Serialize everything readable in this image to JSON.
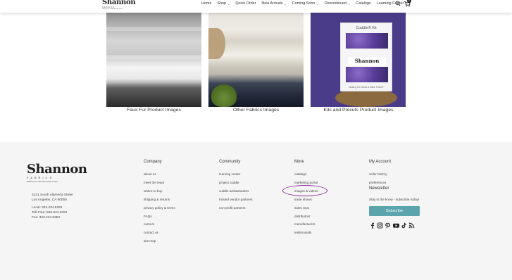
{
  "header": {
    "logo": {
      "brand": "Shannon",
      "sub": "FABRICS",
      "tag": "Making The World A Softer Place"
    },
    "nav": [
      {
        "label": "Home",
        "dropdown": false
      },
      {
        "label": "Shop",
        "dropdown": true
      },
      {
        "label": "Quick Order",
        "dropdown": false
      },
      {
        "label": "New Arrivals",
        "dropdown": true
      },
      {
        "label": "Coming Soon",
        "dropdown": true
      },
      {
        "label": "Discontinued",
        "dropdown": true
      },
      {
        "label": "Catalogs",
        "dropdown": false
      },
      {
        "label": "Learning Center",
        "dropdown": true
      }
    ],
    "cart_count": "0",
    "icons": {
      "search": "search-icon",
      "cart": "cart-icon"
    }
  },
  "tiles": [
    {
      "caption": "Faux Fur Product Images"
    },
    {
      "caption": "Other Fabrics Images"
    },
    {
      "caption": "Kits and Precuts Product Images",
      "kit_title": "Cuddle® Kit",
      "kit_logo": "Shannon",
      "kit_tagline": "Making The World A Softer Place®"
    }
  ],
  "footer": {
    "logo": {
      "brand": "Shannon",
      "sub": "FABRICS",
      "tag": "Making The World A Softer Place"
    },
    "address": [
      "3131 South Alameda Street",
      "Los Angeles, CA 90058"
    ],
    "phones": [
      "Local: 323.234.5252",
      "Toll Free: 866.624.5252",
      "Fax: 323.234.5353"
    ],
    "company": {
      "heading": "Company",
      "links": [
        "about us",
        "meet the team",
        "where to buy",
        "shipping & returns",
        "privacy policy & terms",
        "FAQs",
        "careers",
        "contact us",
        "site map"
      ]
    },
    "community": {
      "heading": "Community",
      "links": [
        "learning center",
        "project cuddle",
        "cuddle ambassadors",
        "trusted vendor partners",
        "non-profit partners"
      ]
    },
    "more": {
      "heading": "More",
      "links": [
        "catalogs",
        "marketing portal",
        "images & videos",
        "trade shows",
        "sales reps",
        "distributors",
        "manufacturers",
        "testimonials"
      ]
    },
    "account": {
      "heading": "My Account",
      "links": [
        "order history",
        "preferences"
      ]
    },
    "newsletter": {
      "heading": "Newsletter",
      "text": "Stay in the know - subscribe today!",
      "button": "Subscribe",
      "button_color": "#5ba4ab"
    },
    "social_icons": [
      "facebook-icon",
      "instagram-icon",
      "pinterest-icon",
      "youtube-icon",
      "tiktok-icon",
      "rss-icon"
    ],
    "highlight_color": "#8b2c9c"
  }
}
